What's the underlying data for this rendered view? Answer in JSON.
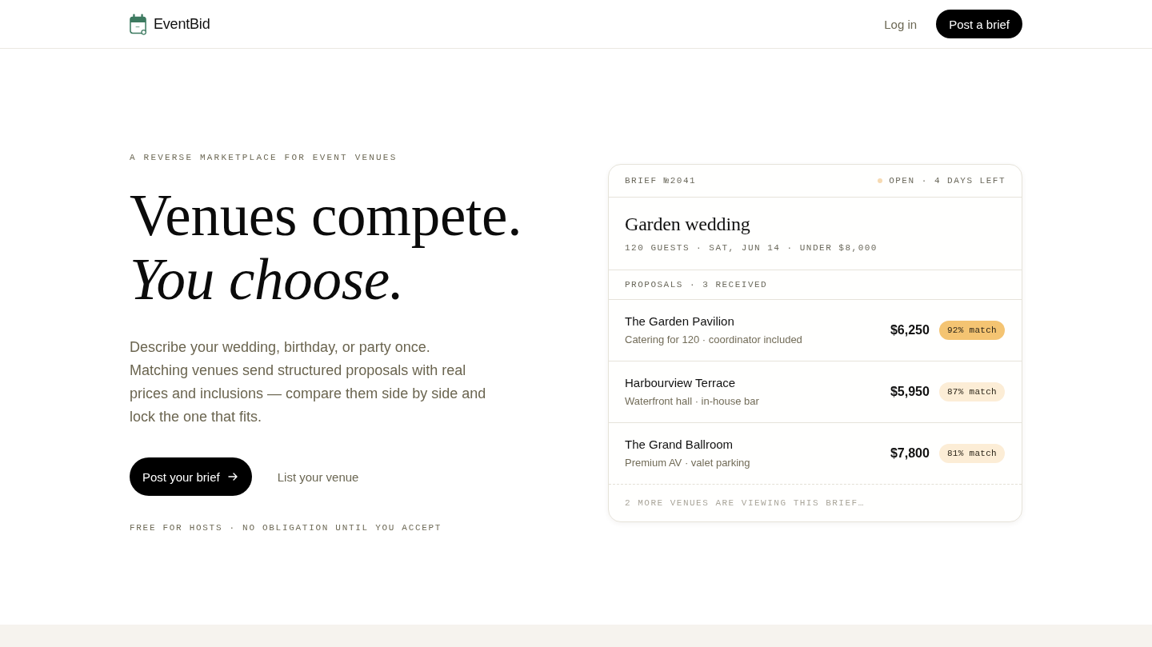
{
  "nav": {
    "brand": "EventBid",
    "links": [
      {
        "label": "Log in",
        "kind": "link"
      },
      {
        "label": "Post a brief",
        "kind": "button"
      }
    ]
  },
  "hero": {
    "eyebrow": "A REVERSE MARKETPLACE FOR EVENT VENUES",
    "headline": "Venues compete.",
    "headline_accent": "You choose.",
    "description": "Describe your wedding, birthday, or party once. Matching venues send structured proposals with real prices and inclusions — compare them side by side and lock the one that fits.",
    "actions": [
      {
        "label": "Post your brief",
        "kind": "primary"
      },
      {
        "label": "List your venue",
        "kind": "link"
      }
    ],
    "note": "FREE FOR HOSTS · NO OBLIGATION UNTIL YOU ACCEPT"
  },
  "brief_card": {
    "brief_id": "BRIEF №2041",
    "status": "OPEN · 4 DAYS LEFT",
    "title": "Garden wedding",
    "details": "120 GUESTS · SAT, JUN 14 · UNDER $8,000",
    "proposals_label": "PROPOSALS · 3 RECEIVED",
    "proposals": [
      {
        "venue": "The Garden Pavilion",
        "summary": "Catering for 120 · coordinator included",
        "price": "$6,250",
        "match": "92% match",
        "color": "#f4c472"
      },
      {
        "venue": "Harbourview Terrace",
        "summary": "Waterfront hall · in-house bar",
        "price": "$5,950",
        "match": "87% match",
        "color": "#fcedd6"
      },
      {
        "venue": "The Grand Ballroom",
        "summary": "Premium AV · valet parking",
        "price": "$7,800",
        "match": "81% match",
        "color": "#fcedd6"
      }
    ],
    "footer": "2 MORE VENUES ARE VIEWING THIS BRIEF…"
  }
}
